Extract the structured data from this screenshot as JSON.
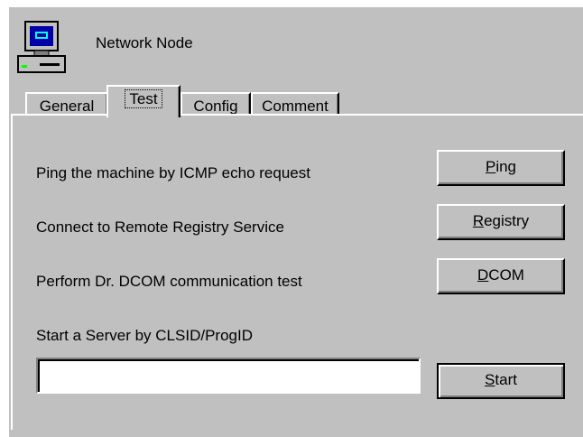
{
  "header": {
    "title": "Network Node",
    "icon": "computer-icon"
  },
  "tabs": [
    {
      "label": "General",
      "active": false
    },
    {
      "label": "Test",
      "active": true
    },
    {
      "label": "Config",
      "active": false
    },
    {
      "label": "Comment",
      "active": false
    }
  ],
  "test_panel": {
    "ping": {
      "description": "Ping the machine by ICMP echo request",
      "button_label": "Ping",
      "mnemonic": "P"
    },
    "registry": {
      "description": "Connect to Remote Registry Service",
      "button_label": "Registry",
      "mnemonic": "R"
    },
    "dcom": {
      "description": "Perform Dr. DCOM communication test",
      "button_label": "DCOM",
      "mnemonic": "D"
    },
    "server": {
      "description": "Start a Server by CLSID/ProgID",
      "input_value": "",
      "button_label": "Start",
      "mnemonic": "S"
    }
  },
  "colors": {
    "face": "#c0c0c0",
    "highlight": "#ffffff",
    "shadow": "#808080",
    "dark_shadow": "#000000",
    "icon_screen": "#0000a8",
    "icon_body": "#c0c0c0"
  }
}
